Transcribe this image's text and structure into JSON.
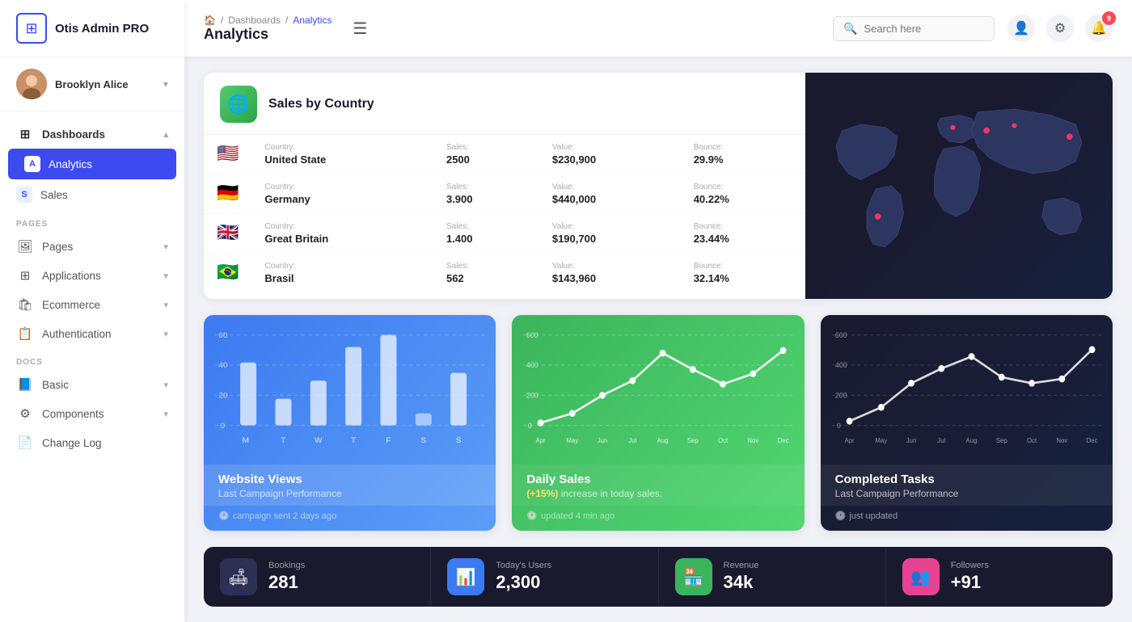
{
  "app": {
    "name": "Otis Admin PRO",
    "logo_char": "⊞"
  },
  "user": {
    "name": "Brooklyn Alice",
    "avatar_char": "🧑"
  },
  "sidebar": {
    "nav": [
      {
        "id": "dashboards",
        "label": "Dashboards",
        "icon": "⊞",
        "active": false,
        "parent": true,
        "chevron": true
      },
      {
        "id": "analytics",
        "label": "Analytics",
        "icon": "A",
        "active": true,
        "badge": null
      },
      {
        "id": "sales",
        "label": "Sales",
        "icon": "S",
        "active": false
      }
    ],
    "pages_label": "PAGES",
    "pages": [
      {
        "id": "pages",
        "label": "Pages",
        "icon": "🖼",
        "chevron": true
      },
      {
        "id": "applications",
        "label": "Applications",
        "icon": "⊞",
        "chevron": true
      },
      {
        "id": "ecommerce",
        "label": "Ecommerce",
        "icon": "🛍",
        "chevron": true
      },
      {
        "id": "authentication",
        "label": "Authentication",
        "icon": "📋",
        "chevron": true
      }
    ],
    "docs_label": "DOCS",
    "docs": [
      {
        "id": "basic",
        "label": "Basic",
        "icon": "📘",
        "chevron": true
      },
      {
        "id": "components",
        "label": "Components",
        "icon": "⚙",
        "chevron": true
      },
      {
        "id": "changelog",
        "label": "Change Log",
        "icon": "📄"
      }
    ]
  },
  "header": {
    "breadcrumb": [
      "🏠",
      "/",
      "Dashboards",
      "/",
      "Analytics"
    ],
    "title": "Analytics",
    "menu_icon": "☰",
    "search_placeholder": "Search here",
    "notif_count": "9"
  },
  "sales_by_country": {
    "title": "Sales by Country",
    "rows": [
      {
        "flag": "🇺🇸",
        "country_label": "Country:",
        "country": "United State",
        "sales_label": "Sales:",
        "sales": "2500",
        "value_label": "Value:",
        "value": "$230,900",
        "bounce_label": "Bounce:",
        "bounce": "29.9%"
      },
      {
        "flag": "🇩🇪",
        "country_label": "Country:",
        "country": "Germany",
        "sales_label": "Sales:",
        "sales": "3.900",
        "value_label": "Value:",
        "value": "$440,000",
        "bounce_label": "Bounce:",
        "bounce": "40.22%"
      },
      {
        "flag": "🇬🇧",
        "country_label": "Country:",
        "country": "Great Britain",
        "sales_label": "Sales:",
        "sales": "1.400",
        "value_label": "Value:",
        "value": "$190,700",
        "bounce_label": "Bounce:",
        "bounce": "23.44%"
      },
      {
        "flag": "🇧🇷",
        "country_label": "Country:",
        "country": "Brasil",
        "sales_label": "Sales:",
        "sales": "562",
        "value_label": "Value:",
        "value": "$143,960",
        "bounce_label": "Bounce:",
        "bounce": "32.14%"
      }
    ]
  },
  "charts": {
    "website_views": {
      "title": "Website Views",
      "subtitle": "Last Campaign Performance",
      "footer": "campaign sent 2 days ago",
      "y_labels": [
        "60",
        "40",
        "20",
        "0"
      ],
      "x_labels": [
        "M",
        "T",
        "W",
        "T",
        "F",
        "S",
        "S"
      ],
      "bars": [
        42,
        18,
        30,
        52,
        60,
        8,
        35
      ]
    },
    "daily_sales": {
      "title": "Daily Sales",
      "subtitle_prefix": "(+15%)",
      "subtitle_text": " increase in today sales.",
      "footer": "updated 4 min ago",
      "y_labels": [
        "600",
        "400",
        "200",
        "0"
      ],
      "x_labels": [
        "Apr",
        "May",
        "Jun",
        "Jul",
        "Aug",
        "Sep",
        "Oct",
        "Nov",
        "Dec"
      ],
      "points": [
        20,
        80,
        200,
        300,
        480,
        380,
        280,
        350,
        500
      ]
    },
    "completed_tasks": {
      "title": "Completed Tasks",
      "subtitle": "Last Campaign Performance",
      "footer": "just updated",
      "y_labels": [
        "600",
        "400",
        "200",
        "0"
      ],
      "x_labels": [
        "Apr",
        "May",
        "Jun",
        "Jul",
        "Aug",
        "Sep",
        "Oct",
        "Nov",
        "Dec"
      ],
      "points": [
        30,
        120,
        280,
        380,
        460,
        320,
        280,
        310,
        500
      ]
    }
  },
  "stats": [
    {
      "id": "bookings",
      "icon": "🛋",
      "icon_style": "dark-gray",
      "label": "Bookings",
      "value": "281"
    },
    {
      "id": "today_users",
      "icon": "📊",
      "icon_style": "blue",
      "label": "Today's Users",
      "value": "2,300"
    },
    {
      "id": "revenue",
      "icon": "🏪",
      "icon_style": "green",
      "label": "Revenue",
      "value": "34k"
    },
    {
      "id": "followers",
      "icon": "👥",
      "icon_style": "pink",
      "label": "Followers",
      "value": "+91"
    }
  ]
}
